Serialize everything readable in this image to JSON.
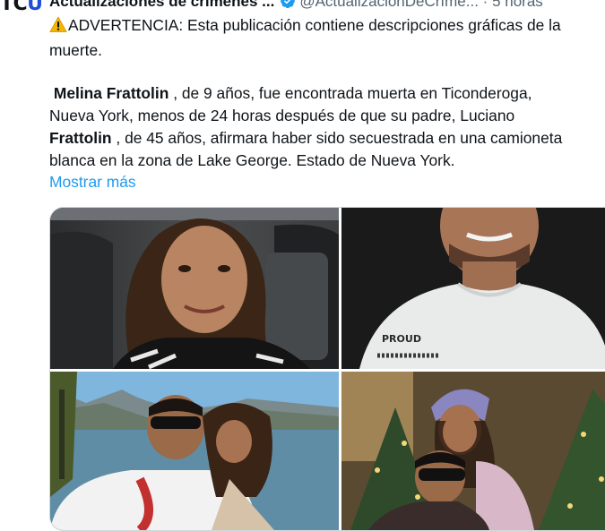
{
  "author": {
    "avatar_text_1": "TC",
    "avatar_text_2": "U",
    "display_name": "Actualizaciones de crímenes ...",
    "verified": true,
    "handle": "@ActualizaciónDeCríme...",
    "separator": "·",
    "time": "5 horas"
  },
  "tweet": {
    "warning_emoji": "warning-icon",
    "line1": "ADVERTENCIA: Esta publicación contiene descripciones gráficas de la",
    "line2": "muerte.",
    "name1": "Melina Frattolin",
    "p2_a": ", de 9 años, fue encontrada muerta en Ticonderoga,",
    "p2_b": "Nueva York, menos de 24 horas después de que su padre, Luciano",
    "name2": "Frattolin",
    "p2_c": ", de 45 años, afirmara haber sido secuestrada en una camioneta",
    "p2_d": "blanca en la zona de Lake George. Estado de Nueva York.",
    "show_more": "Mostrar más"
  },
  "media": {
    "count": 4,
    "photo3_shirt_text": "PROUD"
  },
  "colors": {
    "link": "#1d9bf0",
    "verified": "#1d9bf0",
    "secondary_text": "#536471",
    "primary_text": "#0f1419"
  }
}
